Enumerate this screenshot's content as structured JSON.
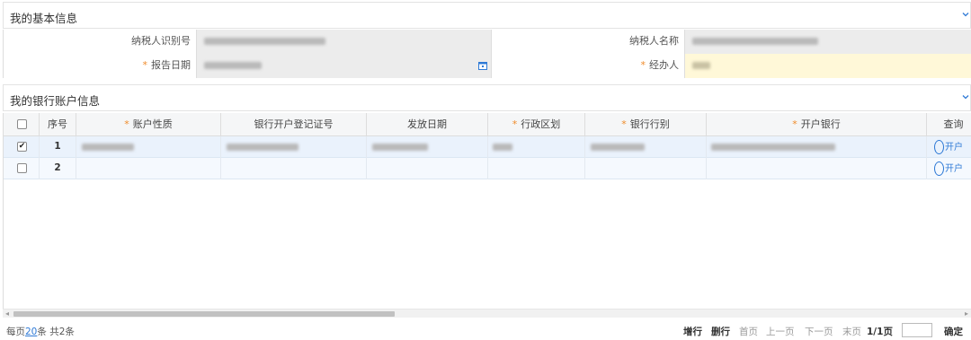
{
  "basic_info": {
    "title": "我的基本信息",
    "taxpayer_id_label": "纳税人识别号",
    "taxpayer_name_label": "纳税人名称",
    "report_date_label": "报告日期",
    "agent_label": "经办人",
    "required_mark": "*",
    "collapse_icon": "chevron-down-icon"
  },
  "bank_section": {
    "title": "我的银行账户信息",
    "collapse_icon": "chevron-down-icon"
  },
  "table": {
    "columns": [
      "序号",
      "账户性质",
      "银行开户登记证号",
      "发放日期",
      "行政区划",
      "银行行别",
      "开户银行",
      "查询"
    ],
    "required_columns": [
      "账户性质",
      "行政区划",
      "银行行别",
      "开户银行"
    ],
    "rows": [
      {
        "index": "1",
        "checked": true,
        "query_text": "开户"
      },
      {
        "index": "2",
        "checked": false,
        "query_text": "开户"
      }
    ]
  },
  "footer": {
    "per_page_prefix": "每页",
    "per_page_value": "20",
    "per_page_suffix": "条 共2条",
    "add_row": "增行",
    "delete_row": "删行",
    "first_page": "首页",
    "prev_page": "上一页",
    "next_page": "下一页",
    "last_page": "末页",
    "page_info": "1/1页",
    "confirm": "确定"
  },
  "colors": {
    "accent": "#2f7ad6",
    "required": "#f08b2a",
    "readonly_bg": "#ececec",
    "editable_bg": "#fff8d8",
    "selected_row_bg": "#eaf2fc"
  }
}
